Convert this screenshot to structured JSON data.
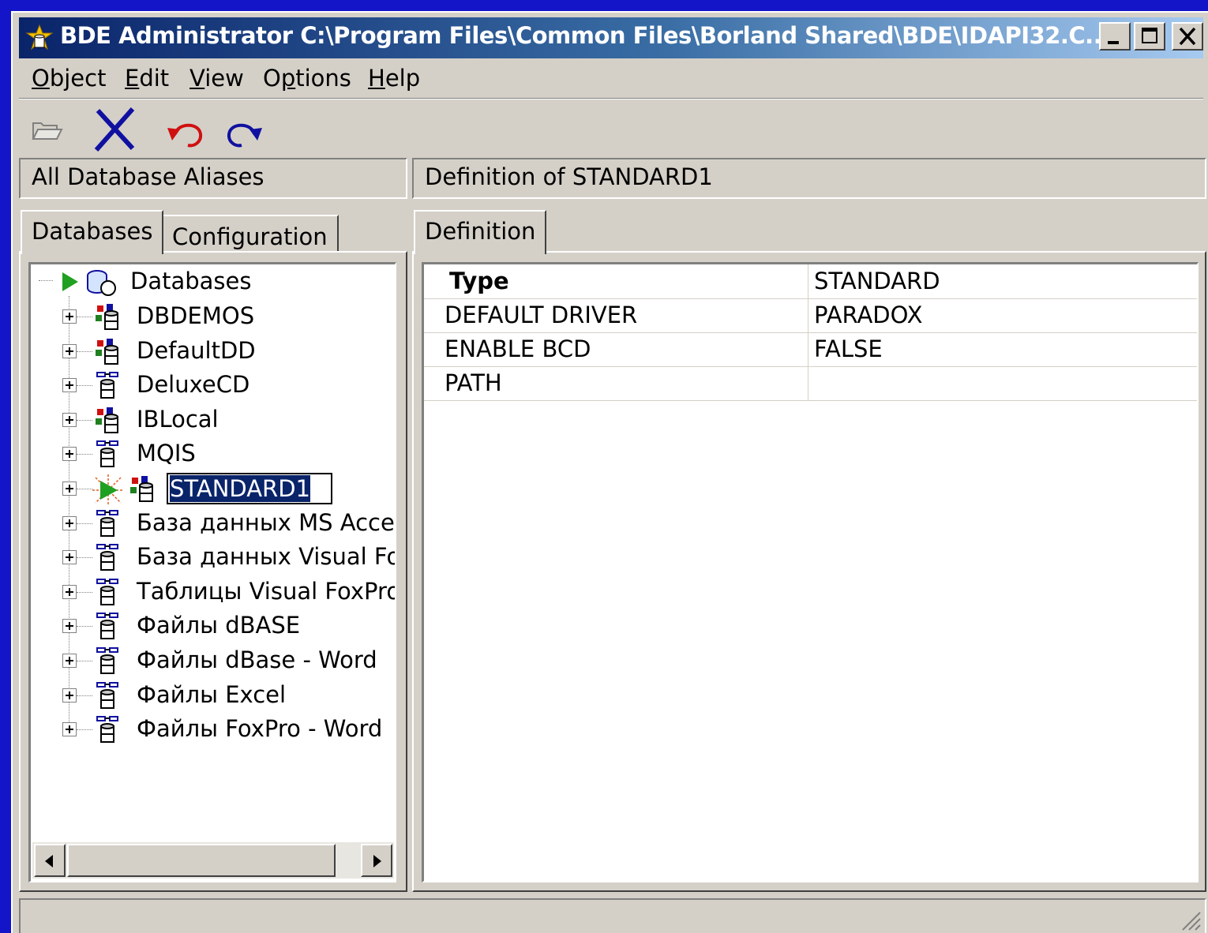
{
  "window": {
    "title": "BDE Administrator  C:\\Program Files\\Common Files\\Borland Shared\\BDE\\IDAPI32.C...",
    "minimize_icon": "minimize-icon",
    "maximize_icon": "maximize-icon",
    "close_icon": "close-icon"
  },
  "menu": {
    "items": [
      {
        "label_u": "O",
        "label_rest": "bject"
      },
      {
        "label_u": "E",
        "label_rest": "dit"
      },
      {
        "label_u": "V",
        "label_rest": "iew"
      },
      {
        "label_pre": "O",
        "label_u": "p",
        "label_rest": "tions"
      },
      {
        "label_u": "H",
        "label_rest": "elp"
      }
    ]
  },
  "toolbar": {
    "icons": [
      "open-folder-icon",
      "delete-icon",
      "undo-icon",
      "redo-icon"
    ]
  },
  "left_panel": {
    "header": "All Database Aliases",
    "tabs": [
      "Databases",
      "Configuration"
    ],
    "tree": {
      "root": "Databases",
      "items": [
        {
          "label": "DBDEMOS",
          "icon": "database-icon"
        },
        {
          "label": "DefaultDD",
          "icon": "database-icon"
        },
        {
          "label": "DeluxeCD",
          "icon": "odbc-database-icon"
        },
        {
          "label": "IBLocal",
          "icon": "database-icon"
        },
        {
          "label": "MQIS",
          "icon": "odbc-database-icon"
        },
        {
          "label": "STANDARD1",
          "icon": "database-icon",
          "selected": true,
          "editing": true
        },
        {
          "label": "База данных MS Acces",
          "icon": "odbc-database-icon"
        },
        {
          "label": "База данных Visual FoxF",
          "icon": "odbc-database-icon"
        },
        {
          "label": "Таблицы Visual FoxPro",
          "icon": "odbc-database-icon"
        },
        {
          "label": "Файлы dBASE",
          "icon": "odbc-database-icon"
        },
        {
          "label": "Файлы dBase - Word",
          "icon": "odbc-database-icon"
        },
        {
          "label": "Файлы Excel",
          "icon": "odbc-database-icon"
        },
        {
          "label": "Файлы FoxPro - Word",
          "icon": "odbc-database-icon"
        }
      ]
    }
  },
  "right_panel": {
    "header": "Definition of STANDARD1",
    "tabs": [
      "Definition"
    ],
    "rows": [
      {
        "key": "Type",
        "value": "STANDARD"
      },
      {
        "key": "DEFAULT DRIVER",
        "value": "PARADOX"
      },
      {
        "key": "ENABLE BCD",
        "value": "FALSE"
      },
      {
        "key": "PATH",
        "value": ""
      }
    ]
  },
  "colors": {
    "desktop": "#1414c8",
    "title_start": "#0a246a",
    "title_end": "#a6caf0",
    "face": "#d4d0c8",
    "selection": "#0a246a"
  }
}
